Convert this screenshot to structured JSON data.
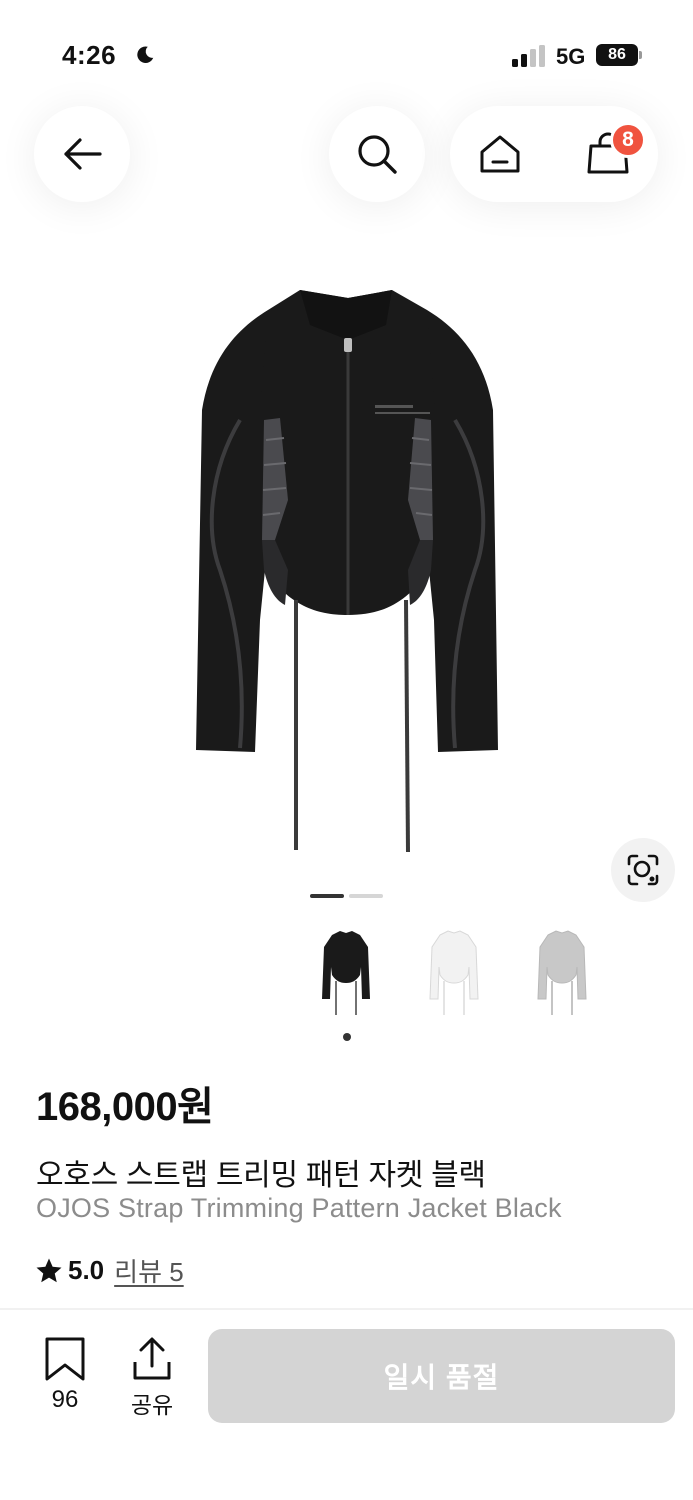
{
  "status_bar": {
    "time": "4:26",
    "network": "5G",
    "battery": "86"
  },
  "header": {
    "cart_count": "8",
    "icons": [
      "arrow-left-icon",
      "search-icon",
      "home-icon",
      "shopping-bag-icon"
    ]
  },
  "gallery": {
    "image_count": 2,
    "active_index": 0,
    "color_variants": [
      "Black",
      "White",
      "Grey"
    ],
    "selected_variant": 0
  },
  "product": {
    "price": "168,000원",
    "name_ko": "오호스 스트랩 트리밍 패턴 자켓 블랙",
    "name_en": "OJOS Strap Trimming Pattern Jacket Black",
    "rating": "5.0",
    "review_label": "리뷰 5"
  },
  "bottom_bar": {
    "bookmark_count": "96",
    "share_label": "공유",
    "buy_label": "일시 품절"
  },
  "colors": {
    "badge": "#f0533f",
    "disabled_button": "#d4d4d4",
    "jacket_black": "#1a1a1a",
    "jacket_white": "#f2f2f2",
    "jacket_grey": "#c8c8c8"
  }
}
